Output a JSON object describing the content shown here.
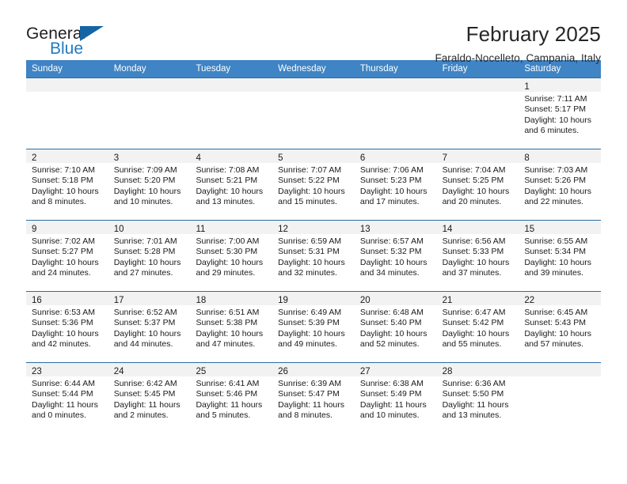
{
  "brand": {
    "name_part1": "General",
    "name_part2": "Blue",
    "triangle_color": "#1565a5",
    "blue_color": "#1f7ac0"
  },
  "header": {
    "title": "February 2025",
    "subtitle": "Faraldo-Nocelleto, Campania, Italy"
  },
  "theme": {
    "header_blue": "#3f84c4",
    "row_border_blue": "#2e6da4",
    "band_gray": "#f2f2f2"
  },
  "weekday_headers": [
    "Sunday",
    "Monday",
    "Tuesday",
    "Wednesday",
    "Thursday",
    "Friday",
    "Saturday"
  ],
  "weeks": [
    {
      "days": [
        {
          "num": "",
          "sunrise": "",
          "sunset": "",
          "daylight_line1": "",
          "daylight_line2": ""
        },
        {
          "num": "",
          "sunrise": "",
          "sunset": "",
          "daylight_line1": "",
          "daylight_line2": ""
        },
        {
          "num": "",
          "sunrise": "",
          "sunset": "",
          "daylight_line1": "",
          "daylight_line2": ""
        },
        {
          "num": "",
          "sunrise": "",
          "sunset": "",
          "daylight_line1": "",
          "daylight_line2": ""
        },
        {
          "num": "",
          "sunrise": "",
          "sunset": "",
          "daylight_line1": "",
          "daylight_line2": ""
        },
        {
          "num": "",
          "sunrise": "",
          "sunset": "",
          "daylight_line1": "",
          "daylight_line2": ""
        },
        {
          "num": "1",
          "sunrise": "Sunrise: 7:11 AM",
          "sunset": "Sunset: 5:17 PM",
          "daylight_line1": "Daylight: 10 hours",
          "daylight_line2": "and 6 minutes."
        }
      ]
    },
    {
      "days": [
        {
          "num": "2",
          "sunrise": "Sunrise: 7:10 AM",
          "sunset": "Sunset: 5:18 PM",
          "daylight_line1": "Daylight: 10 hours",
          "daylight_line2": "and 8 minutes."
        },
        {
          "num": "3",
          "sunrise": "Sunrise: 7:09 AM",
          "sunset": "Sunset: 5:20 PM",
          "daylight_line1": "Daylight: 10 hours",
          "daylight_line2": "and 10 minutes."
        },
        {
          "num": "4",
          "sunrise": "Sunrise: 7:08 AM",
          "sunset": "Sunset: 5:21 PM",
          "daylight_line1": "Daylight: 10 hours",
          "daylight_line2": "and 13 minutes."
        },
        {
          "num": "5",
          "sunrise": "Sunrise: 7:07 AM",
          "sunset": "Sunset: 5:22 PM",
          "daylight_line1": "Daylight: 10 hours",
          "daylight_line2": "and 15 minutes."
        },
        {
          "num": "6",
          "sunrise": "Sunrise: 7:06 AM",
          "sunset": "Sunset: 5:23 PM",
          "daylight_line1": "Daylight: 10 hours",
          "daylight_line2": "and 17 minutes."
        },
        {
          "num": "7",
          "sunrise": "Sunrise: 7:04 AM",
          "sunset": "Sunset: 5:25 PM",
          "daylight_line1": "Daylight: 10 hours",
          "daylight_line2": "and 20 minutes."
        },
        {
          "num": "8",
          "sunrise": "Sunrise: 7:03 AM",
          "sunset": "Sunset: 5:26 PM",
          "daylight_line1": "Daylight: 10 hours",
          "daylight_line2": "and 22 minutes."
        }
      ]
    },
    {
      "days": [
        {
          "num": "9",
          "sunrise": "Sunrise: 7:02 AM",
          "sunset": "Sunset: 5:27 PM",
          "daylight_line1": "Daylight: 10 hours",
          "daylight_line2": "and 24 minutes."
        },
        {
          "num": "10",
          "sunrise": "Sunrise: 7:01 AM",
          "sunset": "Sunset: 5:28 PM",
          "daylight_line1": "Daylight: 10 hours",
          "daylight_line2": "and 27 minutes."
        },
        {
          "num": "11",
          "sunrise": "Sunrise: 7:00 AM",
          "sunset": "Sunset: 5:30 PM",
          "daylight_line1": "Daylight: 10 hours",
          "daylight_line2": "and 29 minutes."
        },
        {
          "num": "12",
          "sunrise": "Sunrise: 6:59 AM",
          "sunset": "Sunset: 5:31 PM",
          "daylight_line1": "Daylight: 10 hours",
          "daylight_line2": "and 32 minutes."
        },
        {
          "num": "13",
          "sunrise": "Sunrise: 6:57 AM",
          "sunset": "Sunset: 5:32 PM",
          "daylight_line1": "Daylight: 10 hours",
          "daylight_line2": "and 34 minutes."
        },
        {
          "num": "14",
          "sunrise": "Sunrise: 6:56 AM",
          "sunset": "Sunset: 5:33 PM",
          "daylight_line1": "Daylight: 10 hours",
          "daylight_line2": "and 37 minutes."
        },
        {
          "num": "15",
          "sunrise": "Sunrise: 6:55 AM",
          "sunset": "Sunset: 5:34 PM",
          "daylight_line1": "Daylight: 10 hours",
          "daylight_line2": "and 39 minutes."
        }
      ]
    },
    {
      "days": [
        {
          "num": "16",
          "sunrise": "Sunrise: 6:53 AM",
          "sunset": "Sunset: 5:36 PM",
          "daylight_line1": "Daylight: 10 hours",
          "daylight_line2": "and 42 minutes."
        },
        {
          "num": "17",
          "sunrise": "Sunrise: 6:52 AM",
          "sunset": "Sunset: 5:37 PM",
          "daylight_line1": "Daylight: 10 hours",
          "daylight_line2": "and 44 minutes."
        },
        {
          "num": "18",
          "sunrise": "Sunrise: 6:51 AM",
          "sunset": "Sunset: 5:38 PM",
          "daylight_line1": "Daylight: 10 hours",
          "daylight_line2": "and 47 minutes."
        },
        {
          "num": "19",
          "sunrise": "Sunrise: 6:49 AM",
          "sunset": "Sunset: 5:39 PM",
          "daylight_line1": "Daylight: 10 hours",
          "daylight_line2": "and 49 minutes."
        },
        {
          "num": "20",
          "sunrise": "Sunrise: 6:48 AM",
          "sunset": "Sunset: 5:40 PM",
          "daylight_line1": "Daylight: 10 hours",
          "daylight_line2": "and 52 minutes."
        },
        {
          "num": "21",
          "sunrise": "Sunrise: 6:47 AM",
          "sunset": "Sunset: 5:42 PM",
          "daylight_line1": "Daylight: 10 hours",
          "daylight_line2": "and 55 minutes."
        },
        {
          "num": "22",
          "sunrise": "Sunrise: 6:45 AM",
          "sunset": "Sunset: 5:43 PM",
          "daylight_line1": "Daylight: 10 hours",
          "daylight_line2": "and 57 minutes."
        }
      ]
    },
    {
      "days": [
        {
          "num": "23",
          "sunrise": "Sunrise: 6:44 AM",
          "sunset": "Sunset: 5:44 PM",
          "daylight_line1": "Daylight: 11 hours",
          "daylight_line2": "and 0 minutes."
        },
        {
          "num": "24",
          "sunrise": "Sunrise: 6:42 AM",
          "sunset": "Sunset: 5:45 PM",
          "daylight_line1": "Daylight: 11 hours",
          "daylight_line2": "and 2 minutes."
        },
        {
          "num": "25",
          "sunrise": "Sunrise: 6:41 AM",
          "sunset": "Sunset: 5:46 PM",
          "daylight_line1": "Daylight: 11 hours",
          "daylight_line2": "and 5 minutes."
        },
        {
          "num": "26",
          "sunrise": "Sunrise: 6:39 AM",
          "sunset": "Sunset: 5:47 PM",
          "daylight_line1": "Daylight: 11 hours",
          "daylight_line2": "and 8 minutes."
        },
        {
          "num": "27",
          "sunrise": "Sunrise: 6:38 AM",
          "sunset": "Sunset: 5:49 PM",
          "daylight_line1": "Daylight: 11 hours",
          "daylight_line2": "and 10 minutes."
        },
        {
          "num": "28",
          "sunrise": "Sunrise: 6:36 AM",
          "sunset": "Sunset: 5:50 PM",
          "daylight_line1": "Daylight: 11 hours",
          "daylight_line2": "and 13 minutes."
        },
        {
          "num": "",
          "sunrise": "",
          "sunset": "",
          "daylight_line1": "",
          "daylight_line2": ""
        }
      ]
    }
  ]
}
